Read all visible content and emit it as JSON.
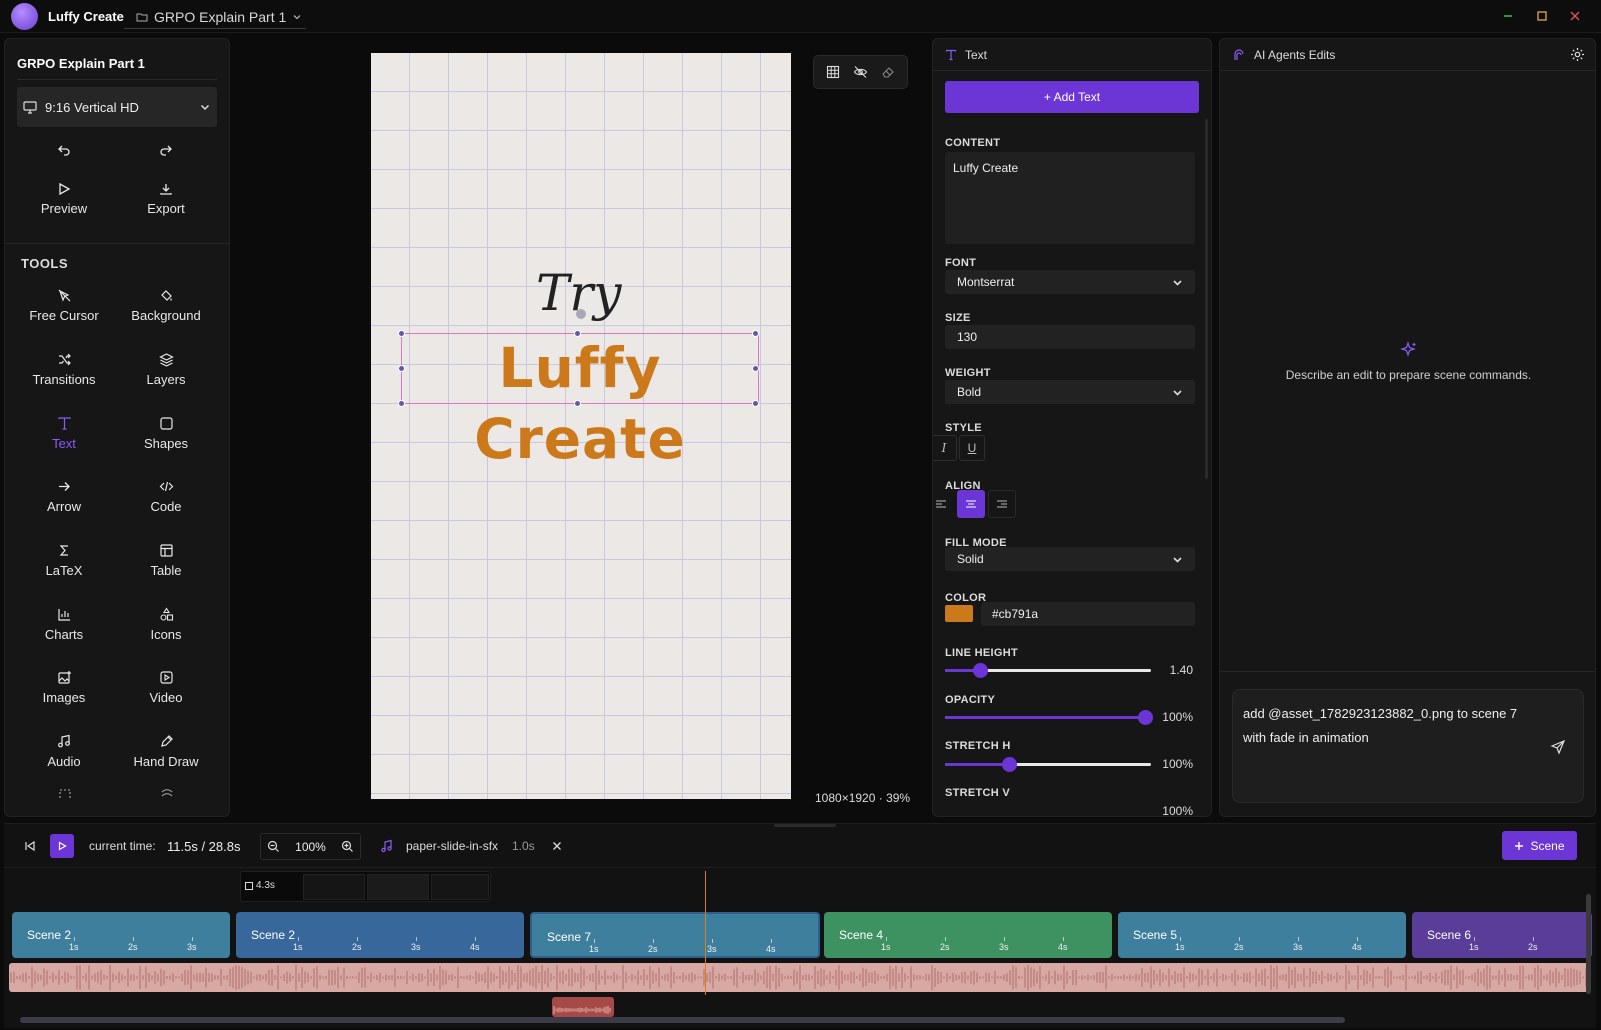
{
  "app": {
    "name": "Luffy Create",
    "project_tab": "GRPO Explain Part 1"
  },
  "left_panel": {
    "project_title": "GRPO Explain Part 1",
    "resolution": "9:16 Vertical HD",
    "preview_label": "Preview",
    "export_label": "Export",
    "tools_title": "TOOLS",
    "tools": [
      {
        "label": "Free Cursor",
        "icon": "cursor-off-icon"
      },
      {
        "label": "Background",
        "icon": "paint-bucket-icon"
      },
      {
        "label": "Transitions",
        "icon": "shuffle-icon"
      },
      {
        "label": "Layers",
        "icon": "layers-icon"
      },
      {
        "label": "Text",
        "icon": "text-icon"
      },
      {
        "label": "Shapes",
        "icon": "square-icon"
      },
      {
        "label": "Arrow",
        "icon": "arrow-right-icon"
      },
      {
        "label": "Code",
        "icon": "code-icon"
      },
      {
        "label": "LaTeX",
        "icon": "sigma-icon"
      },
      {
        "label": "Table",
        "icon": "table-icon"
      },
      {
        "label": "Charts",
        "icon": "bar-chart-icon"
      },
      {
        "label": "Icons",
        "icon": "shapes-icon"
      },
      {
        "label": "Images",
        "icon": "image-plus-icon"
      },
      {
        "label": "Video",
        "icon": "video-icon"
      },
      {
        "label": "Audio",
        "icon": "music-icon"
      },
      {
        "label": "Hand Draw",
        "icon": "pen-icon"
      }
    ]
  },
  "canvas": {
    "try_text": "Try",
    "main_text": "Luffy Create",
    "info": "1080×1920 · 39%"
  },
  "text_panel": {
    "title": "Text",
    "add_button": "+ Add Text",
    "content_label": "CONTENT",
    "content_value": "Luffy Create",
    "font_label": "FONT",
    "font_value": "Montserrat",
    "size_label": "SIZE",
    "size_value": "130",
    "weight_label": "WEIGHT",
    "weight_value": "Bold",
    "style_label": "STYLE",
    "italic_glyph": "I",
    "underline_glyph": "U",
    "align_label": "ALIGN",
    "align_selected": "center",
    "fill_mode_label": "FILL MODE",
    "fill_mode_value": "Solid",
    "color_label": "COLOR",
    "color_value": "#cb791a",
    "line_height_label": "LINE HEIGHT",
    "line_height_value": "1.40",
    "line_height_fraction": 0.17,
    "opacity_label": "OPACITY",
    "opacity_value": "100%",
    "opacity_fraction": 0.97,
    "stretch_h_label": "STRETCH H",
    "stretch_h_value": "100%",
    "stretch_h_fraction": 0.31,
    "stretch_v_label": "STRETCH V",
    "stretch_v_value": "100%"
  },
  "ai_panel": {
    "title": "AI Agents Edits",
    "empty_text": "Describe an edit to prepare scene commands.",
    "input_value": "add @asset_1782923123882_0.png to scene 7 with fade in animation"
  },
  "timeline": {
    "current_time_label": "current time:",
    "current_time_value": "11.5s / 28.8s",
    "zoom_value": "100%",
    "audio_clip_name": "paper-slide-in-sfx",
    "audio_clip_duration": "1.0s",
    "add_scene_label": "Scene",
    "clip_badge": "4.3s",
    "scenes": [
      {
        "name": "Scene 2",
        "ticks": [
          "1s",
          "2s",
          "3s"
        ],
        "color": "#3f7f9e"
      },
      {
        "name": "Scene 2",
        "ticks": [
          "1s",
          "2s",
          "3s",
          "4s"
        ],
        "color": "#38679c"
      },
      {
        "name": "Scene 7",
        "ticks": [
          "1s",
          "2s",
          "3s",
          "4s"
        ],
        "color": "#3f7f9e"
      },
      {
        "name": "Scene 4",
        "ticks": [
          "1s",
          "2s",
          "3s",
          "4s"
        ],
        "color": "#3e9160"
      },
      {
        "name": "Scene 5",
        "ticks": [
          "1s",
          "2s",
          "3s",
          "4s"
        ],
        "color": "#3f7f9e"
      },
      {
        "name": "Scene 6",
        "ticks": [
          "1s",
          "2s"
        ],
        "color": "#5a3d98"
      }
    ]
  },
  "colors": {
    "accent": "#6c35d6",
    "text_color": "#cb791a",
    "playhead": "#e07b1e"
  }
}
